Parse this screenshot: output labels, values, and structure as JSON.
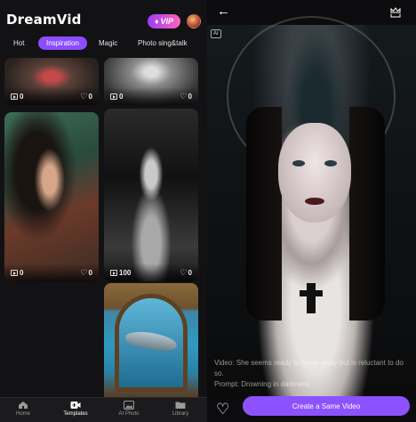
{
  "app": {
    "brand": "DreamVid",
    "vip_label": "VIP"
  },
  "tabs": [
    {
      "label": "Hot",
      "active": false
    },
    {
      "label": "Inspiration",
      "active": true
    },
    {
      "label": "Magic",
      "active": false
    },
    {
      "label": "Photo sing&talk",
      "active": false
    }
  ],
  "cards": [
    {
      "uses": "0",
      "likes": "0"
    },
    {
      "uses": "0",
      "likes": "0"
    },
    {
      "uses": "0",
      "likes": "0"
    },
    {
      "uses": "100",
      "likes": "0"
    }
  ],
  "bottom_nav": [
    {
      "label": "Home",
      "active": false,
      "icon": "home-icon"
    },
    {
      "label": "Templates",
      "active": true,
      "icon": "video-plus-icon"
    },
    {
      "label": "AI Photo",
      "active": false,
      "icon": "image-icon"
    },
    {
      "label": "Library",
      "active": false,
      "icon": "folder-icon"
    }
  ],
  "detail": {
    "ai_badge": "AI",
    "caption_line1": "Video: She seems ready to move away but is reluctant to do so.",
    "caption_line2": "Prompt: Drowning in darkness",
    "cta_label": "Create a Same Video"
  },
  "colors": {
    "accent": "#8b4dff",
    "vip_gradient_start": "#9b3df5",
    "vip_gradient_end": "#ff63b8",
    "background": "#121214"
  }
}
